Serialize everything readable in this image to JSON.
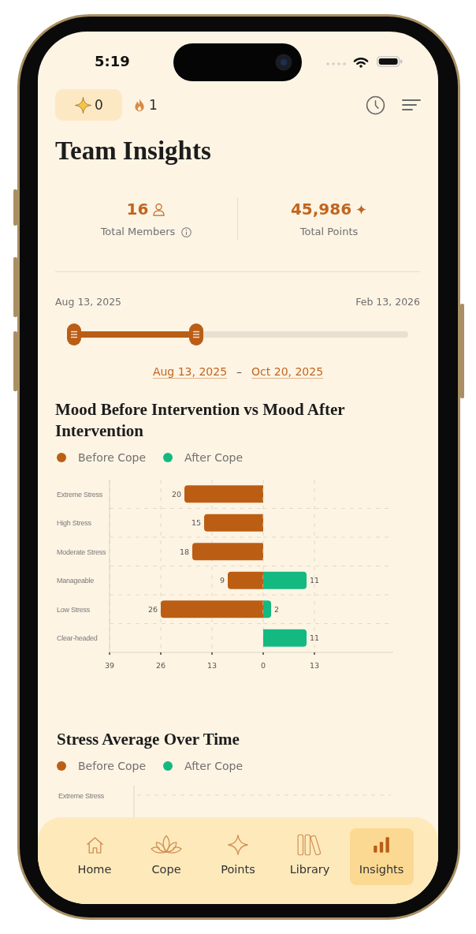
{
  "status_bar": {
    "time": "5:19"
  },
  "header": {
    "points": "0",
    "streak": "1"
  },
  "title": "Team Insights",
  "stats": [
    {
      "kind": "members",
      "value": "16",
      "label": "Total Members"
    },
    {
      "kind": "points",
      "value": "45,986",
      "label": "Total Points"
    }
  ],
  "date_range": {
    "min_label": "Aug 13, 2025",
    "max_label": "Feb 13, 2026",
    "thumbs": [
      {
        "level": 0
      },
      {
        "level": 0.37
      }
    ],
    "selected_start": "Aug 13, 2025",
    "separator": "–",
    "selected_end": "Oct 20, 2025"
  },
  "mood_chart": {
    "title": "Mood Before Intervention vs Mood After Intervention",
    "panels": [
      {
        "chart_data": {
          "type": "bar",
          "orientation": "horizontal",
          "grid": true,
          "categories": [
            "Extreme Stress",
            "High Stress",
            "Moderate Stress",
            "Manageable",
            "Low Stress",
            "Clear-headed"
          ],
          "series": [
            {
              "name": "Before Cope",
              "color": "#bb5e14",
              "values": [
                20,
                15,
                18,
                9,
                26,
                null
              ]
            }
          ],
          "xlim": [
            39,
            0
          ],
          "xticks": [
            39,
            26,
            13
          ],
          "data_labels": true
        }
      },
      {
        "chart_data": {
          "type": "bar",
          "orientation": "horizontal",
          "grid": true,
          "series": [
            {
              "name": "After Cope",
              "color": "#13b981",
              "values": [
                null,
                null,
                null,
                11,
                2,
                11
              ]
            }
          ],
          "xlim": [
            0,
            33
          ],
          "xticks": [
            0,
            13
          ],
          "data_labels": true
        }
      }
    ]
  },
  "stress_chart": {
    "title": "Stress Average Over Time",
    "legend": [
      {
        "label": "Before Cope",
        "color": "#bb5e14"
      },
      {
        "label": "After Cope",
        "color": "#13b981"
      }
    ],
    "y_labels": [
      "Extreme Stress"
    ]
  },
  "nav": [
    {
      "kind": "home",
      "label": "Home",
      "selected": false
    },
    {
      "kind": "cope",
      "label": "Cope",
      "selected": false
    },
    {
      "kind": "points",
      "label": "Points",
      "selected": false
    },
    {
      "kind": "library",
      "label": "Library",
      "selected": false
    },
    {
      "kind": "insights",
      "label": "Insights",
      "selected": true
    }
  ]
}
